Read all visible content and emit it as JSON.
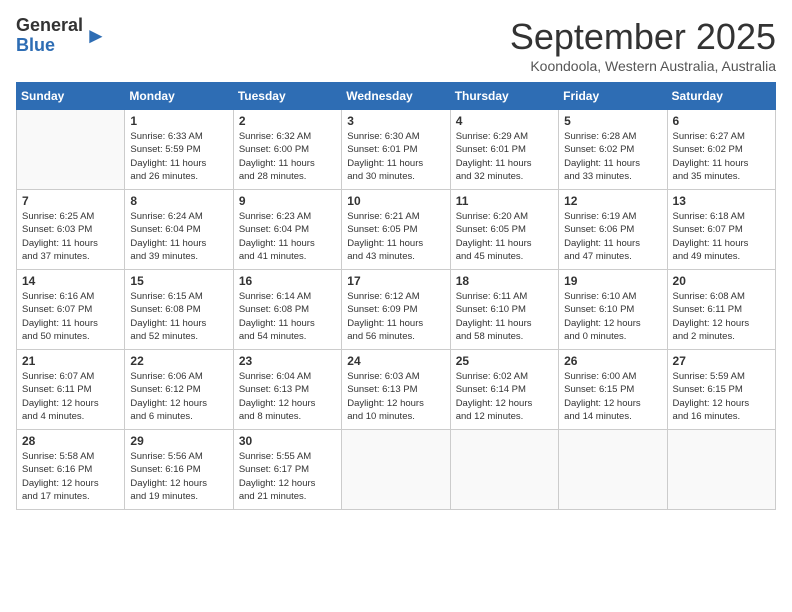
{
  "logo": {
    "general": "General",
    "blue": "Blue"
  },
  "title": "September 2025",
  "subtitle": "Koondoola, Western Australia, Australia",
  "days_of_week": [
    "Sunday",
    "Monday",
    "Tuesday",
    "Wednesday",
    "Thursday",
    "Friday",
    "Saturday"
  ],
  "weeks": [
    [
      {
        "day": "",
        "info": ""
      },
      {
        "day": "1",
        "info": "Sunrise: 6:33 AM\nSunset: 5:59 PM\nDaylight: 11 hours\nand 26 minutes."
      },
      {
        "day": "2",
        "info": "Sunrise: 6:32 AM\nSunset: 6:00 PM\nDaylight: 11 hours\nand 28 minutes."
      },
      {
        "day": "3",
        "info": "Sunrise: 6:30 AM\nSunset: 6:01 PM\nDaylight: 11 hours\nand 30 minutes."
      },
      {
        "day": "4",
        "info": "Sunrise: 6:29 AM\nSunset: 6:01 PM\nDaylight: 11 hours\nand 32 minutes."
      },
      {
        "day": "5",
        "info": "Sunrise: 6:28 AM\nSunset: 6:02 PM\nDaylight: 11 hours\nand 33 minutes."
      },
      {
        "day": "6",
        "info": "Sunrise: 6:27 AM\nSunset: 6:02 PM\nDaylight: 11 hours\nand 35 minutes."
      }
    ],
    [
      {
        "day": "7",
        "info": "Sunrise: 6:25 AM\nSunset: 6:03 PM\nDaylight: 11 hours\nand 37 minutes."
      },
      {
        "day": "8",
        "info": "Sunrise: 6:24 AM\nSunset: 6:04 PM\nDaylight: 11 hours\nand 39 minutes."
      },
      {
        "day": "9",
        "info": "Sunrise: 6:23 AM\nSunset: 6:04 PM\nDaylight: 11 hours\nand 41 minutes."
      },
      {
        "day": "10",
        "info": "Sunrise: 6:21 AM\nSunset: 6:05 PM\nDaylight: 11 hours\nand 43 minutes."
      },
      {
        "day": "11",
        "info": "Sunrise: 6:20 AM\nSunset: 6:05 PM\nDaylight: 11 hours\nand 45 minutes."
      },
      {
        "day": "12",
        "info": "Sunrise: 6:19 AM\nSunset: 6:06 PM\nDaylight: 11 hours\nand 47 minutes."
      },
      {
        "day": "13",
        "info": "Sunrise: 6:18 AM\nSunset: 6:07 PM\nDaylight: 11 hours\nand 49 minutes."
      }
    ],
    [
      {
        "day": "14",
        "info": "Sunrise: 6:16 AM\nSunset: 6:07 PM\nDaylight: 11 hours\nand 50 minutes."
      },
      {
        "day": "15",
        "info": "Sunrise: 6:15 AM\nSunset: 6:08 PM\nDaylight: 11 hours\nand 52 minutes."
      },
      {
        "day": "16",
        "info": "Sunrise: 6:14 AM\nSunset: 6:08 PM\nDaylight: 11 hours\nand 54 minutes."
      },
      {
        "day": "17",
        "info": "Sunrise: 6:12 AM\nSunset: 6:09 PM\nDaylight: 11 hours\nand 56 minutes."
      },
      {
        "day": "18",
        "info": "Sunrise: 6:11 AM\nSunset: 6:10 PM\nDaylight: 11 hours\nand 58 minutes."
      },
      {
        "day": "19",
        "info": "Sunrise: 6:10 AM\nSunset: 6:10 PM\nDaylight: 12 hours\nand 0 minutes."
      },
      {
        "day": "20",
        "info": "Sunrise: 6:08 AM\nSunset: 6:11 PM\nDaylight: 12 hours\nand 2 minutes."
      }
    ],
    [
      {
        "day": "21",
        "info": "Sunrise: 6:07 AM\nSunset: 6:11 PM\nDaylight: 12 hours\nand 4 minutes."
      },
      {
        "day": "22",
        "info": "Sunrise: 6:06 AM\nSunset: 6:12 PM\nDaylight: 12 hours\nand 6 minutes."
      },
      {
        "day": "23",
        "info": "Sunrise: 6:04 AM\nSunset: 6:13 PM\nDaylight: 12 hours\nand 8 minutes."
      },
      {
        "day": "24",
        "info": "Sunrise: 6:03 AM\nSunset: 6:13 PM\nDaylight: 12 hours\nand 10 minutes."
      },
      {
        "day": "25",
        "info": "Sunrise: 6:02 AM\nSunset: 6:14 PM\nDaylight: 12 hours\nand 12 minutes."
      },
      {
        "day": "26",
        "info": "Sunrise: 6:00 AM\nSunset: 6:15 PM\nDaylight: 12 hours\nand 14 minutes."
      },
      {
        "day": "27",
        "info": "Sunrise: 5:59 AM\nSunset: 6:15 PM\nDaylight: 12 hours\nand 16 minutes."
      }
    ],
    [
      {
        "day": "28",
        "info": "Sunrise: 5:58 AM\nSunset: 6:16 PM\nDaylight: 12 hours\nand 17 minutes."
      },
      {
        "day": "29",
        "info": "Sunrise: 5:56 AM\nSunset: 6:16 PM\nDaylight: 12 hours\nand 19 minutes."
      },
      {
        "day": "30",
        "info": "Sunrise: 5:55 AM\nSunset: 6:17 PM\nDaylight: 12 hours\nand 21 minutes."
      },
      {
        "day": "",
        "info": ""
      },
      {
        "day": "",
        "info": ""
      },
      {
        "day": "",
        "info": ""
      },
      {
        "day": "",
        "info": ""
      }
    ]
  ]
}
